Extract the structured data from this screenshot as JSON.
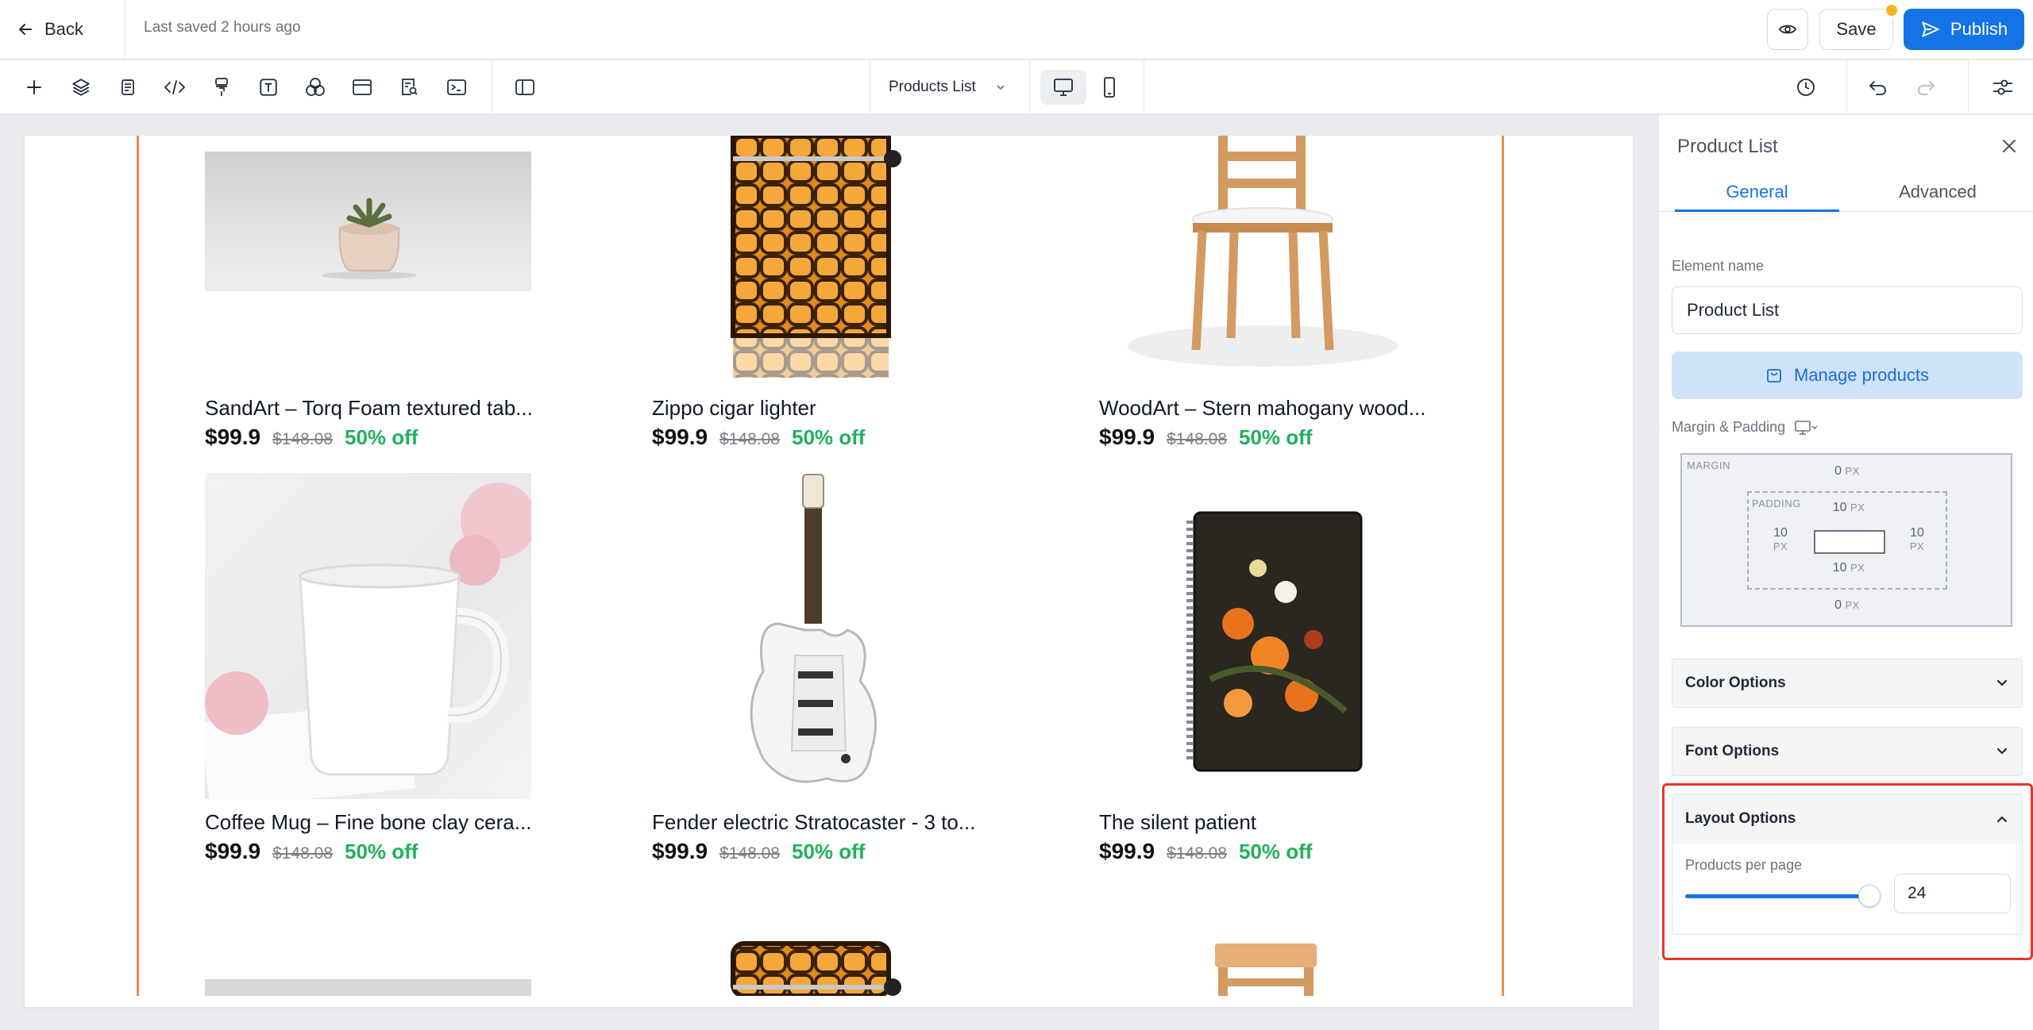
{
  "topbar": {
    "back_label": "Back",
    "last_saved": "Last saved 2 hours ago",
    "save_label": "Save",
    "publish_label": "Publish",
    "accent": "#1473e6",
    "unsaved_dot_color": "#f8b322"
  },
  "toolbar": {
    "tools": [
      "plus-icon",
      "layers-icon",
      "page-icon",
      "code-icon",
      "paint-roller-icon",
      "text-icon",
      "color-circles-icon",
      "section-icon",
      "search-doc-icon",
      "terminal-icon",
      "split-view-icon"
    ],
    "page_select_value": "Products List",
    "devices": [
      "desktop-icon",
      "mobile-icon"
    ],
    "active_device": "desktop-icon",
    "right_tools": [
      "history-icon",
      "undo-icon",
      "redo-icon",
      "settings-sliders-icon"
    ]
  },
  "products": [
    {
      "title": "SandArt – Torq Foam textured tab...",
      "price": "$99.9",
      "old_price": "$148.08",
      "discount": "50% off"
    },
    {
      "title": "Zippo cigar lighter",
      "price": "$99.9",
      "old_price": "$148.08",
      "discount": "50% off"
    },
    {
      "title": "WoodArt – Stern mahogany wood...",
      "price": "$99.9",
      "old_price": "$148.08",
      "discount": "50% off"
    },
    {
      "title": "Coffee Mug – Fine bone clay cera...",
      "price": "$99.9",
      "old_price": "$148.08",
      "discount": "50% off"
    },
    {
      "title": "Fender electric Stratocaster - 3 to...",
      "price": "$99.9",
      "old_price": "$148.08",
      "discount": "50% off"
    },
    {
      "title": "The silent patient",
      "price": "$99.9",
      "old_price": "$148.08",
      "discount": "50% off"
    }
  ],
  "sidebar": {
    "title": "Product List",
    "tabs": [
      "General",
      "Advanced"
    ],
    "active_tab": "General",
    "element_name_label": "Element name",
    "element_name_value": "Product List",
    "manage_products_label": "Manage products",
    "margin_padding_label": "Margin & Padding",
    "box_model": {
      "margin_label": "MARGIN",
      "padding_label": "PADDING",
      "margin_top": "0",
      "margin_bottom": "0",
      "padding_top": "10",
      "padding_bottom": "10",
      "padding_left": "10",
      "padding_right": "10",
      "unit": "PX"
    },
    "accordions": [
      "Color Options",
      "Font Options"
    ],
    "layout": {
      "title": "Layout Options",
      "products_per_page_label": "Products per page",
      "products_per_page_value": "24"
    }
  },
  "colors": {
    "discount_green": "#1fb15a",
    "guide_orange": "#f08a4b",
    "highlight_red": "#e5352a"
  }
}
